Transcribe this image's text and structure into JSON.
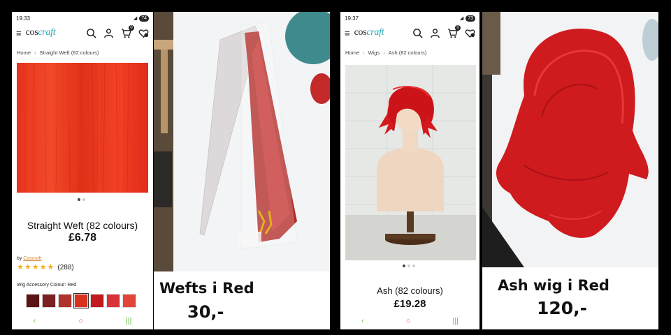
{
  "left_listing": {
    "status": {
      "time": "19.33",
      "battery": "74"
    },
    "logo": {
      "part1": "cos",
      "part2": "craft"
    },
    "cart_count": "0",
    "breadcrumb": [
      "Home",
      "Straight Weft (82 colours)"
    ],
    "product": {
      "title": "Straight Weft (82 colours)",
      "price": "£6.78",
      "by_label": "by",
      "brand": "Coscraft",
      "rating_stars": 5,
      "review_count": "(288)",
      "colour_label": "Wig Accessory Colour: Red"
    },
    "swatch_colors": [
      "#5a1414",
      "#7a1f22",
      "#b0342b",
      "#d9321f",
      "#c21a1f",
      "#d8323a",
      "#e2443a"
    ],
    "photo_caption": {
      "title": "Wefts i Red",
      "price": "30,-"
    }
  },
  "right_listing": {
    "status": {
      "time": "19.37",
      "battery": "73"
    },
    "logo": {
      "part1": "cos",
      "part2": "craft"
    },
    "cart_count": "0",
    "breadcrumb": [
      "Home",
      "Wigs",
      "Ash (82 colours)"
    ],
    "product": {
      "title": "Ash (82 colours)",
      "price": "£19.28"
    },
    "photo_caption": {
      "title": "Ash wig i Red",
      "price": "120,-"
    }
  },
  "nav_glyphs": {
    "back": "‹",
    "home": "○",
    "recents": "|||"
  }
}
